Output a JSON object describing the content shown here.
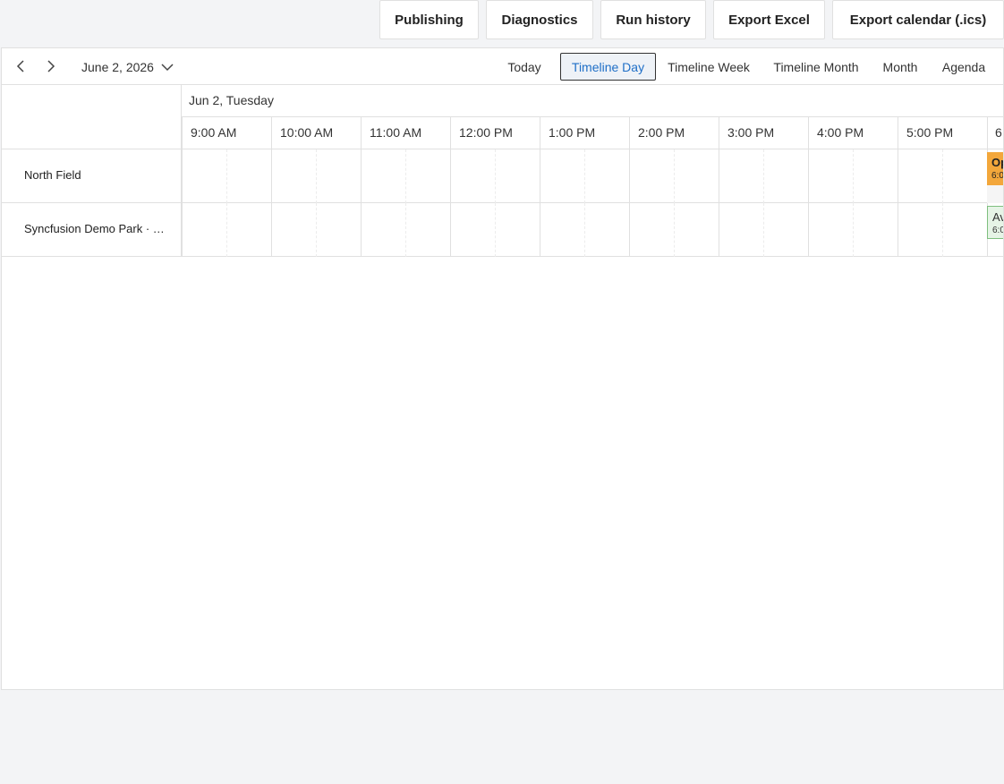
{
  "actions": {
    "publishing": "Publishing",
    "diagnostics": "Diagnostics",
    "run_history": "Run history",
    "export_excel": "Export Excel",
    "export_calendar": "Export calendar (.ics)"
  },
  "toolbar": {
    "date_range": "June 2, 2026",
    "views": {
      "today": "Today",
      "timeline_day": "Timeline Day",
      "timeline_week": "Timeline Week",
      "timeline_month": "Timeline Month",
      "month": "Month",
      "agenda": "Agenda"
    },
    "active_view": "Timeline Day"
  },
  "header": {
    "date_label": "Jun 2, Tuesday",
    "times": [
      "9:00 AM",
      "10:00 AM",
      "11:00 AM",
      "12:00 PM",
      "1:00 PM",
      "2:00 PM",
      "3:00 PM",
      "4:00 PM",
      "5:00 PM",
      "6"
    ]
  },
  "resources": [
    {
      "name": "North Field"
    },
    {
      "name": "Syncfusion Demo Park · …"
    }
  ],
  "events": [
    {
      "title": "Op",
      "time": "6:0",
      "color": "#f3a73b"
    },
    {
      "title": "Av",
      "time": "6:0",
      "color": "#e6f4e6"
    }
  ],
  "colors": {
    "accent": "#1f6fc7",
    "border": "#e0e0e0",
    "background": "#f3f4f6"
  }
}
